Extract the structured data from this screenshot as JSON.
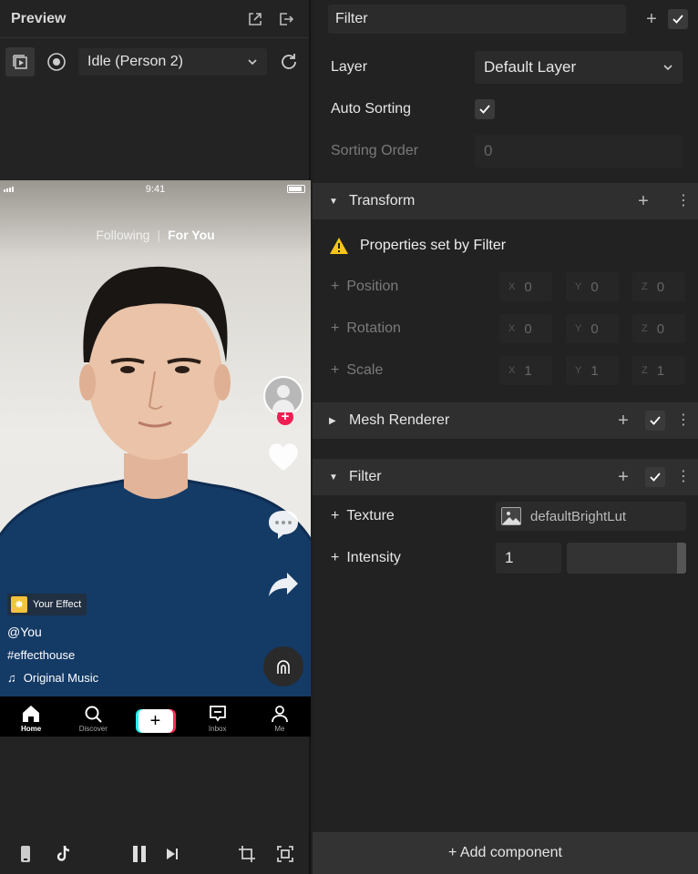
{
  "preview": {
    "title": "Preview",
    "dropdown_value": "Idle (Person 2)",
    "phone": {
      "time": "9:41",
      "tab_following": "Following",
      "tab_for_you": "For You",
      "effect_label": "Your Effect",
      "username": "@You",
      "hashtag": "#effecthouse",
      "music": "Original Music",
      "tabs": [
        {
          "label": "Home"
        },
        {
          "label": "Discover"
        },
        {
          "label": "Inbox"
        },
        {
          "label": "Me"
        }
      ]
    }
  },
  "inspector": {
    "object_name": "Filter",
    "layer_label": "Layer",
    "layer_value": "Default Layer",
    "auto_sorting_label": "Auto Sorting",
    "sorting_order_label": "Sorting Order",
    "sorting_order_value": "0",
    "transform": {
      "title": "Transform",
      "warning": "Properties set by Filter",
      "position_label": "Position",
      "rotation_label": "Rotation",
      "scale_label": "Scale",
      "axis_x": "X",
      "axis_y": "Y",
      "axis_z": "Z",
      "position": [
        "0",
        "0",
        "0"
      ],
      "rotation": [
        "0",
        "0",
        "0"
      ],
      "scale": [
        "1",
        "1",
        "1"
      ]
    },
    "mesh_renderer": {
      "title": "Mesh Renderer"
    },
    "filter": {
      "title": "Filter",
      "texture_label": "Texture",
      "texture_value": "defaultBrightLut",
      "intensity_label": "Intensity",
      "intensity_value": "1"
    },
    "add_component_label": "+ Add component"
  }
}
